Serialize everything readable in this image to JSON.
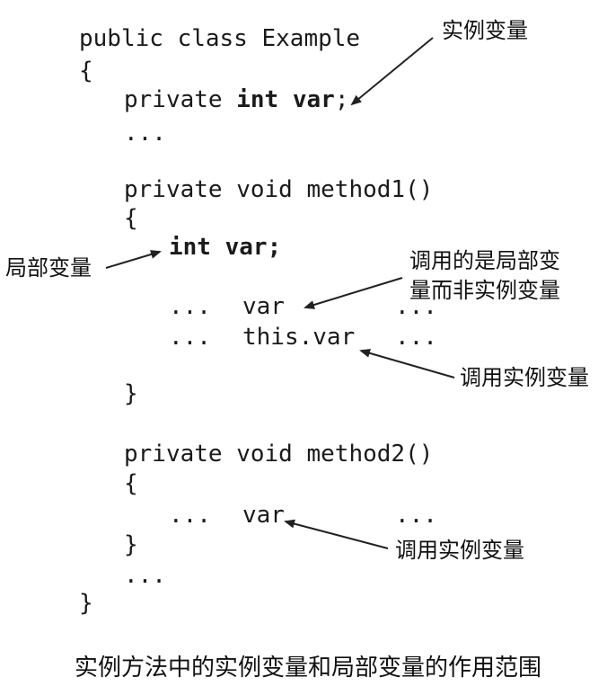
{
  "code": {
    "line1": "public class Example",
    "line2": "{",
    "line3_pre": "private ",
    "line3_bold": "int var",
    "line3_post": ";",
    "line4": "...",
    "line5": "private void method1()",
    "line6": "{",
    "line7_bold": "int var",
    "line7_post": ";",
    "line8_a": "...",
    "line8_b": "var",
    "line8_c": "...",
    "line9_a": "...",
    "line9_b": "this.var",
    "line9_c": "...",
    "line10": "}",
    "line11": "private void method2()",
    "line12": "{",
    "line13_a": "...",
    "line13_b": "var",
    "line13_c": "...",
    "line14": "}",
    "line15": "...",
    "line16": "}"
  },
  "annotations": {
    "instance_var": "实例变量",
    "local_var": "局部变量",
    "calls_local_line1": "调用的是局部变",
    "calls_local_line2": "量而非实例变量",
    "calls_instance_1": "调用实例变量",
    "calls_instance_2": "调用实例变量"
  },
  "caption": "实例方法中的实例变量和局部变量的作用范围",
  "colors": {
    "text": "#111111",
    "arrow": "#222222",
    "background": "#ffffff"
  }
}
